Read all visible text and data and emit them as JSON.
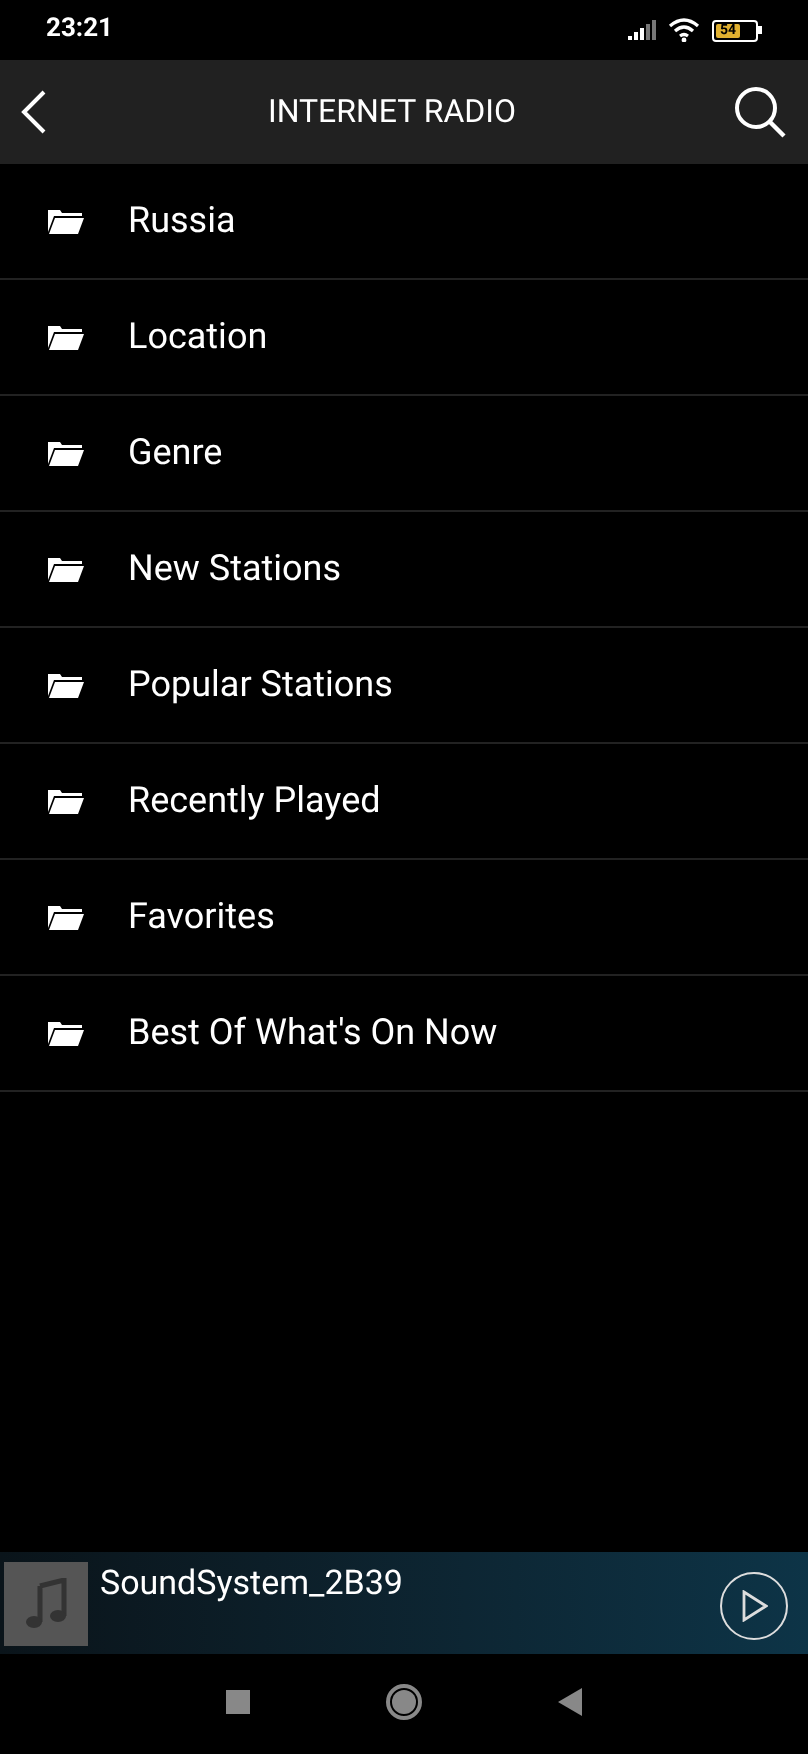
{
  "status_bar": {
    "time": "23:21",
    "battery": "54"
  },
  "header": {
    "title": "INTERNET RADIO"
  },
  "items": [
    {
      "label": "Russia"
    },
    {
      "label": "Location"
    },
    {
      "label": "Genre"
    },
    {
      "label": "New Stations"
    },
    {
      "label": "Popular Stations"
    },
    {
      "label": "Recently Played"
    },
    {
      "label": "Favorites"
    },
    {
      "label": "Best Of What's On Now"
    }
  ],
  "player": {
    "title": "SoundSystem_2B39"
  }
}
